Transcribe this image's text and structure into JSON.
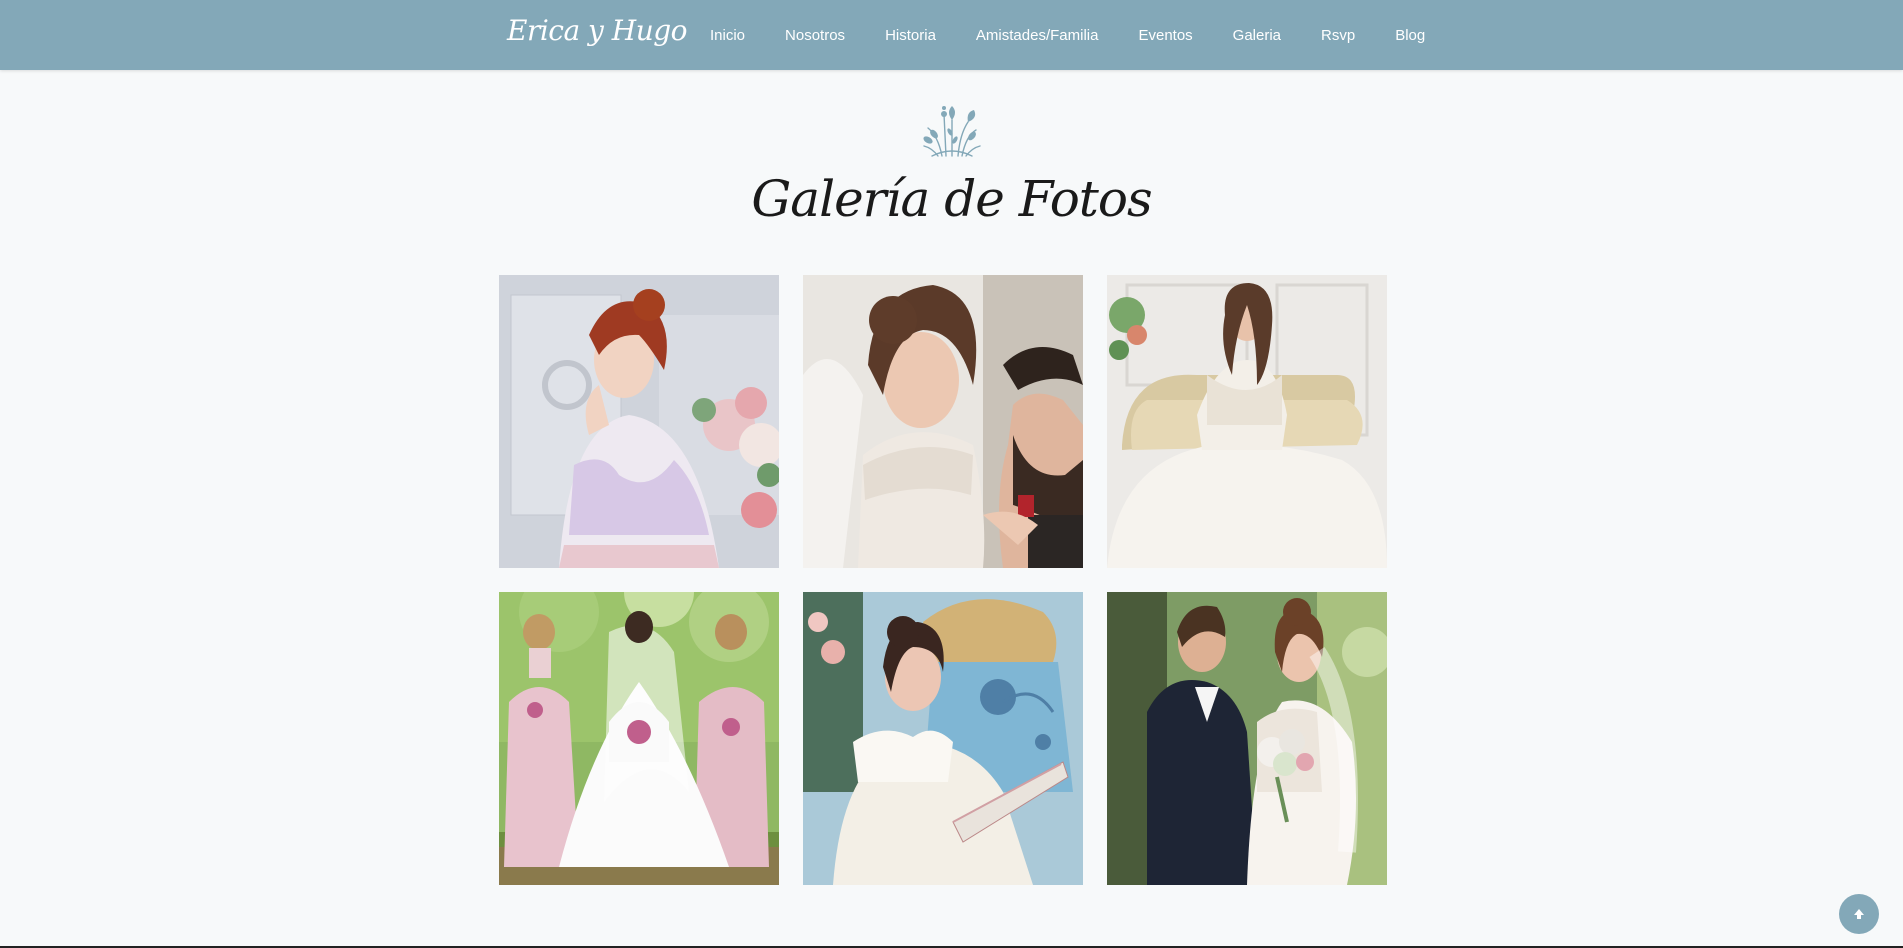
{
  "header": {
    "brand": "Erica y Hugo",
    "nav": [
      "Inicio",
      "Nosotros",
      "Historia",
      "Amistades/Familia",
      "Eventos",
      "Galeria",
      "Rsvp",
      "Blog"
    ]
  },
  "gallery": {
    "title": "Galería de Fotos"
  },
  "colors": {
    "accent": "#83a8b8",
    "background": "#f7f9fa",
    "title": "#1a1a1a"
  },
  "icons": {
    "floral": "floral-ornament-icon",
    "back_to_top": "arrow-up-icon"
  }
}
